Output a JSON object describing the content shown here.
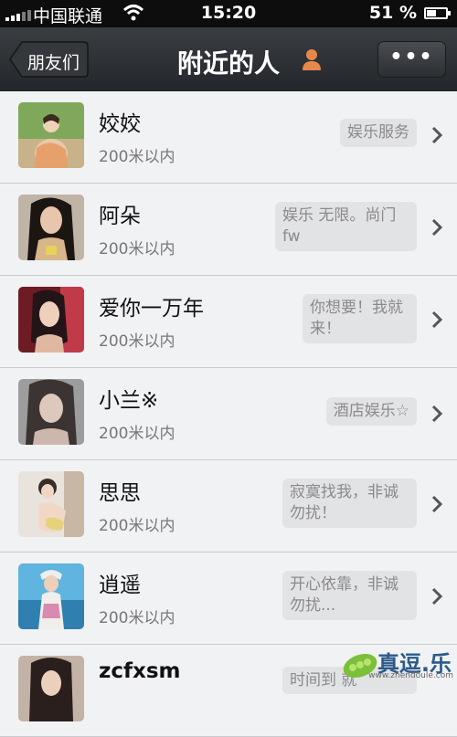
{
  "status": {
    "carrier": "中国联通",
    "time": "15:20",
    "battery": "51 %",
    "battery_level": 0.51
  },
  "nav": {
    "back_label": "朋友们",
    "title": "附近的人",
    "more_label": "•••"
  },
  "people": [
    {
      "name": "姣姣",
      "distance": "200米以内",
      "signature": "娱乐服务"
    },
    {
      "name": "阿朵",
      "distance": "200米以内",
      "signature": "娱乐 无限。尚门fw"
    },
    {
      "name": "爱你一万年",
      "distance": "200米以内",
      "signature": "你想要！我就来！"
    },
    {
      "name": "小兰※",
      "distance": "200米以内",
      "signature": "酒店娱乐☆"
    },
    {
      "name": "思思",
      "distance": "200米以内",
      "signature": "寂寞找我，非诚勿扰！"
    },
    {
      "name": "逍遥",
      "distance": "200米以内",
      "signature": "开心依靠，非诚勿扰..."
    },
    {
      "name": "zcfxsm",
      "distance": "",
      "signature": "时间到 就"
    }
  ],
  "watermark": {
    "text": "真逗.乐",
    "url": "www.zhendoule.com"
  }
}
